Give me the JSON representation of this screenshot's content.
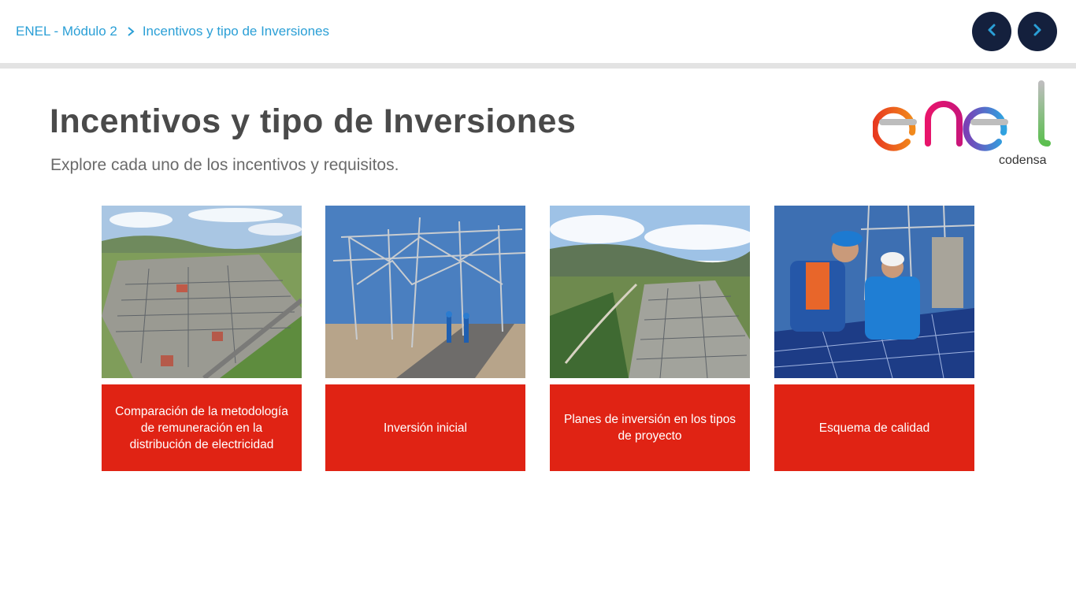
{
  "breadcrumb": {
    "root": "ENEL - Módulo 2",
    "current": "Incentivos y tipo de Inversiones"
  },
  "nav": {
    "prev_icon": "chevron-left-icon",
    "next_icon": "chevron-right-icon"
  },
  "page": {
    "title": "Incentivos y tipo de Inversiones",
    "subtitle": "Explore cada uno de los incentivos y requisitos."
  },
  "logo": {
    "brand": "enel",
    "sub": "codensa"
  },
  "cards": [
    {
      "label": "Comparación de la metodología de remuneración en la distribución de electricidad"
    },
    {
      "label": "Inversión inicial"
    },
    {
      "label": "Planes de inversión en los tipos de proyecto"
    },
    {
      "label": "Esquema de calidad"
    }
  ],
  "colors": {
    "accent_red": "#e02314",
    "nav_dark": "#14203d",
    "link_blue": "#2a9fd6",
    "title_gray": "#4a4a4a"
  }
}
